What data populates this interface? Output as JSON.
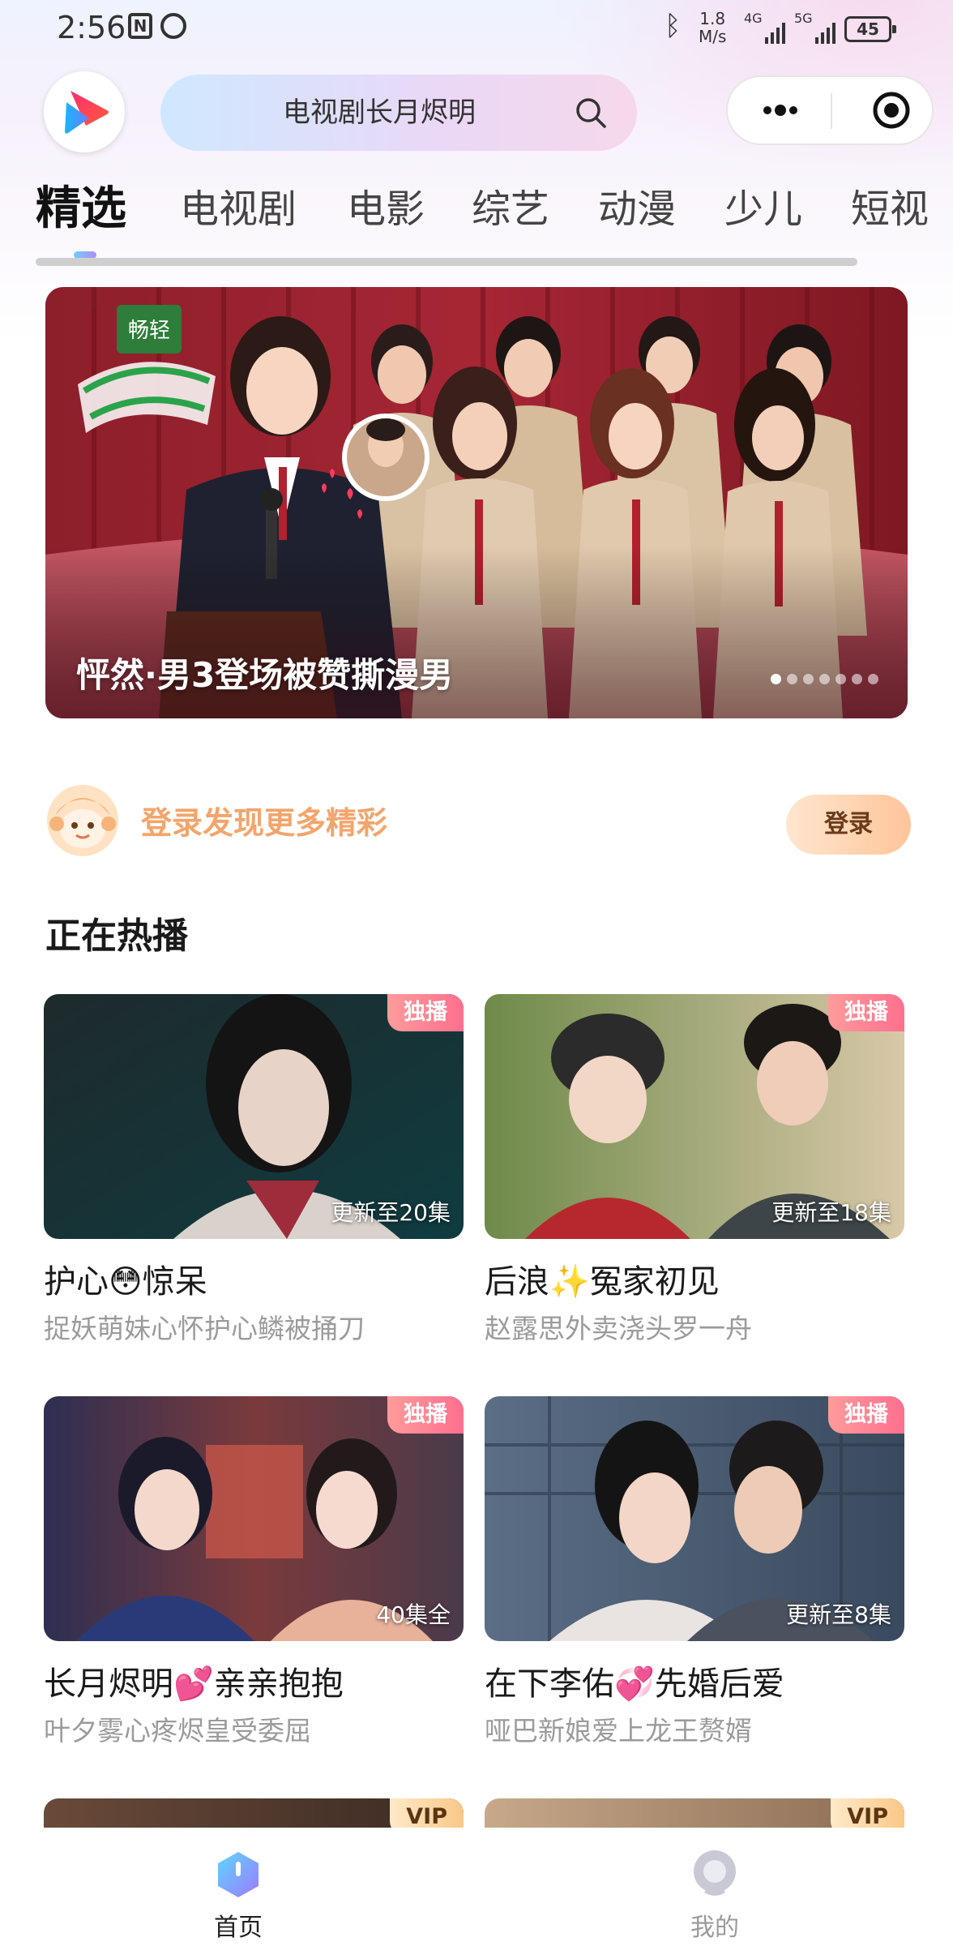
{
  "status_bar": {
    "time": "2:56",
    "speed_value": "1.8",
    "speed_unit": "M/s",
    "signal1": "4G",
    "signal2": "5G",
    "battery": "45"
  },
  "header": {
    "search_placeholder": "电视剧长月烬明"
  },
  "tabs": [
    {
      "label": "精选",
      "active": true
    },
    {
      "label": "电视剧"
    },
    {
      "label": "电影"
    },
    {
      "label": "综艺"
    },
    {
      "label": "动漫"
    },
    {
      "label": "少儿"
    },
    {
      "label": "短视"
    }
  ],
  "banner": {
    "title": "怦然·男3登场被赞撕漫男",
    "dot_count": 7,
    "active_dot": 0
  },
  "login": {
    "text": "登录发现更多精彩",
    "button": "登录"
  },
  "section": {
    "title": "正在热播"
  },
  "cards": [
    {
      "title": "护心😳惊呆",
      "subtitle": "捉妖萌妹心怀护心鳞被捅刀",
      "badge": "独播",
      "episode": "更新至20集"
    },
    {
      "title": "后浪✨冤家初见",
      "subtitle": "赵露思外卖浇头罗一舟",
      "badge": "独播",
      "episode": "更新至18集"
    },
    {
      "title": "长月烬明💕亲亲抱抱",
      "subtitle": "叶夕雾心疼烬皇受委屈",
      "badge": "独播",
      "episode": "40集全"
    },
    {
      "title": "在下李佑💞先婚后爱",
      "subtitle": "哑巴新娘爱上龙王赘婿",
      "badge": "独播",
      "episode": "更新至8集"
    },
    {
      "badge": "VIP"
    },
    {
      "badge": "VIP"
    }
  ],
  "bottom_nav": [
    {
      "label": "首页",
      "active": true
    },
    {
      "label": "我的"
    }
  ],
  "colors": {
    "accent_orange": "#f3a56c",
    "badge_pink": "#ff6f8e",
    "vip_gold": "#f9c887",
    "text_gray": "#9b9b9b"
  }
}
